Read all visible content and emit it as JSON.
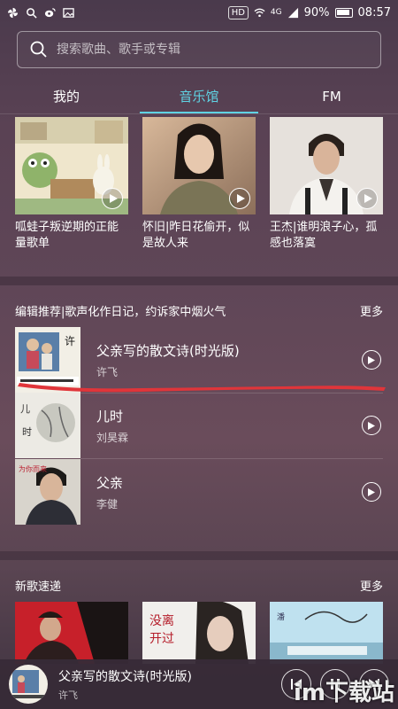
{
  "status_bar": {
    "hd": "HD",
    "network": "4G",
    "battery": "90%",
    "time": "08:57"
  },
  "search": {
    "placeholder": "搜索歌曲、歌手或专辑"
  },
  "tabs": [
    {
      "label": "我的",
      "active": false
    },
    {
      "label": "音乐馆",
      "active": true
    },
    {
      "label": "FM",
      "active": false
    }
  ],
  "accent_color": "#5fd3e4",
  "playlists": [
    {
      "title": "呱蛙子叛逆期的正能量歌单"
    },
    {
      "title": "怀旧|昨日花偷开，似是故人来"
    },
    {
      "title": "王杰|谁明浪子心，孤感也落寞"
    }
  ],
  "editor_section": {
    "heading": "编辑推荐|歌声化作日记，约诉家中烟火气",
    "more": "更多",
    "songs": [
      {
        "title": "父亲写的散文诗(时光版)",
        "artist": "许飞"
      },
      {
        "title": "儿时",
        "artist": "刘昊霖"
      },
      {
        "title": "父亲",
        "artist": "李健"
      }
    ],
    "annotation_color": "#e0353a"
  },
  "new_section": {
    "heading": "新歌速递",
    "more": "更多"
  },
  "player": {
    "title": "父亲写的散文诗(时光版)",
    "artist": "许飞"
  },
  "watermark": "im下载站"
}
